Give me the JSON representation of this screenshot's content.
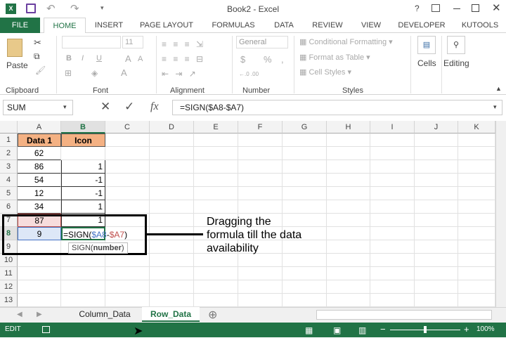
{
  "title": "Book2 - Excel",
  "window_controls": [
    "?",
    "restore-ribbon",
    "minimize",
    "maximize",
    "close"
  ],
  "tabs": [
    "FILE",
    "HOME",
    "INSERT",
    "PAGE LAYOUT",
    "FORMULAS",
    "DATA",
    "REVIEW",
    "VIEW",
    "DEVELOPER",
    "KUTOOLS"
  ],
  "active_tab": "HOME",
  "ribbon": {
    "clipboard": {
      "paste": "Paste",
      "label": "Clipboard"
    },
    "font": {
      "size": "11",
      "bold": "B",
      "italic": "I",
      "underline": "U",
      "grow": "A",
      "shrink": "A",
      "color": "A",
      "label": "Font"
    },
    "alignment": {
      "label": "Alignment"
    },
    "number": {
      "format": "General",
      "currency": "$",
      "percent": "%",
      "comma": ",",
      "label": "Number"
    },
    "styles": {
      "cond": "Conditional Formatting",
      "table": "Format as Table",
      "cellstyles": "Cell Styles",
      "label": "Styles"
    },
    "cells": "Cells",
    "editing": "Editing"
  },
  "formula_bar": {
    "name_box": "SUM",
    "fx": "fx",
    "formula": "=SIGN($A8-$A7)"
  },
  "columns": [
    "A",
    "B",
    "C",
    "D",
    "E",
    "F",
    "G",
    "H",
    "I",
    "J",
    "K"
  ],
  "rows": [
    "1",
    "2",
    "3",
    "4",
    "5",
    "6",
    "7",
    "8",
    "9",
    "10",
    "11",
    "12",
    "13"
  ],
  "cells": {
    "A": [
      "Data 1",
      "62",
      "86",
      "54",
      "12",
      "34",
      "87",
      "9"
    ],
    "B": [
      "Icon",
      "",
      "1",
      "-1",
      "-1",
      "1",
      "1"
    ]
  },
  "edit_cell": {
    "prefix": "=SIGN(",
    "ref1": "$A8",
    "minus": "-",
    "ref2": "$A7",
    "suffix": ")"
  },
  "tooltip": {
    "fn": "SIGN(",
    "arg": "number",
    "close": ")"
  },
  "annotation": "Dragging the formula till the data availability",
  "sheets": [
    "Column_Data",
    "Row_Data"
  ],
  "active_sheet": "Row_Data",
  "status": {
    "mode": "EDIT",
    "zoom": "100%"
  },
  "colors": {
    "excel_green": "#217346",
    "header_orange": "#f4b183",
    "ref_blue": "#4472c4",
    "ref_red": "#c0504d"
  }
}
